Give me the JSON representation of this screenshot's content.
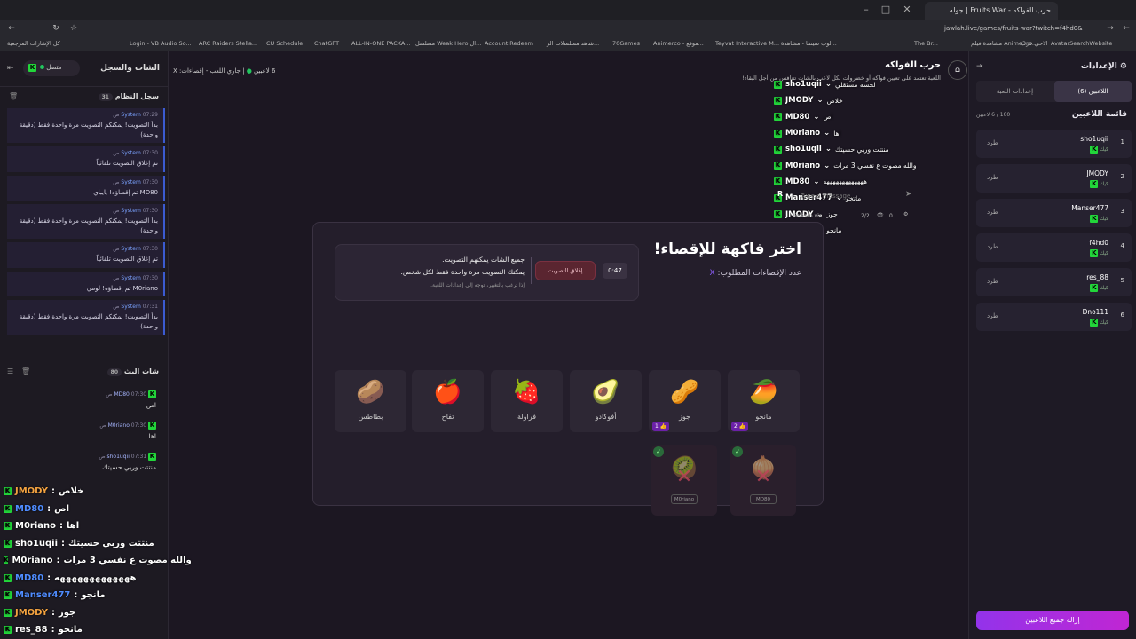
{
  "browser": {
    "tab_title": "حرب الفواكه - Fruits War | جوله",
    "url": "jawlah.live/games/fruits-war?twitch=f4hd0&kick=f4hd0",
    "bookmarks": [
      "كل الإشارات المرجعية",
      "Login - VB Audio So...",
      "ARC Raiders Stella...",
      "CU Schedule",
      "ChatGPT",
      "ALL-IN-ONE PACKA...",
      "مسلسل Weak Hero ال...",
      "Account Redeem",
      "شاهد مسلسلات الر...",
      "70Games",
      "Animerco - موقع...",
      "Teyvat Interactive M...",
      "لوب سينما - مشاهدة...",
      "The Br...",
      "مشاهدة فيلم Anime3rb...",
      "الاحي عرب",
      "AvatarSearchWebsite"
    ]
  },
  "left_panel": {
    "title": "الشات والسجل",
    "status": "متصل",
    "system_log": {
      "title": "سجل النظام",
      "count": "31",
      "messages": [
        {
          "sender": "System",
          "time": "07:29 ص",
          "text": "بدأ التصويت! يمكنكم التصويت مرة واحدة فقط (دقيقة واحدة)"
        },
        {
          "sender": "System",
          "time": "07:30 ص",
          "text": "تم إغلاق التصويت تلقائياً"
        },
        {
          "sender": "System",
          "time": "07:30 ص",
          "text": "MD80 تم إقصاؤه! بايباي"
        },
        {
          "sender": "System",
          "time": "07:30 ص",
          "text": "بدأ التصويت! يمكنكم التصويت مرة واحدة فقط (دقيقة واحدة)"
        },
        {
          "sender": "System",
          "time": "07:30 ص",
          "text": "تم إغلاق التصويت تلقائياً"
        },
        {
          "sender": "System",
          "time": "07:30 ص",
          "text": "M0riano تم إقصاؤه! لومي"
        },
        {
          "sender": "System",
          "time": "07:31 ص",
          "text": "بدأ التصويت! يمكنكم التصويت مرة واحدة فقط (دقيقة واحدة)"
        }
      ]
    },
    "stream_chat": {
      "title": "شات البث",
      "count": "80",
      "messages": [
        {
          "user": "MD80",
          "time": "07:30 ص",
          "text": "اص"
        },
        {
          "user": "M0riano",
          "time": "07:30 ص",
          "text": "اها"
        },
        {
          "user": "sho1uqii",
          "time": "07:31 ص",
          "text": "منتتت وربي حسيتك"
        }
      ]
    }
  },
  "overlay_chat": [
    {
      "user": "JMODY",
      "text": "خلاص",
      "color": "#f4a340"
    },
    {
      "user": "MD80",
      "text": "اص",
      "color": "#4f8cff"
    },
    {
      "user": "M0riano",
      "text": "اها",
      "color": "#ffffff"
    },
    {
      "user": "sho1uqii",
      "text": "منتتت وربي حسيتك",
      "color": "#ffffff"
    },
    {
      "user": "M0riano",
      "text": "والله مصوت ع نفسي 3 مرات",
      "color": "#ffffff"
    },
    {
      "user": "MD80",
      "text": "هههههههههههههه",
      "color": "#4f8cff"
    },
    {
      "user": "Manser477",
      "text": "مانجو",
      "color": "#4f8cff"
    },
    {
      "user": "JMODY",
      "text": "جوز",
      "color": "#f4a340"
    },
    {
      "user": "res_88",
      "text": "مانجو",
      "color": "#ffffff"
    }
  ],
  "top_chat": [
    {
      "user": "sho1uqii",
      "text": "لحسه مستقلي"
    },
    {
      "user": "JMODY",
      "text": "خلاص"
    },
    {
      "user": "MD80",
      "text": "اص"
    },
    {
      "user": "M0riano",
      "text": "اها"
    },
    {
      "user": "sho1uqii",
      "text": "منتتت وربي حسيتك"
    },
    {
      "user": "M0riano",
      "text": "والله مصوت ع نفسي 3 مرات"
    },
    {
      "user": "MD80",
      "text": "هههههههههههههه"
    },
    {
      "user": "Manser477",
      "text": "مانجو"
    },
    {
      "user": "JMODY",
      "text": "جوز"
    },
    {
      "user": "res_88",
      "text": "مانجو"
    }
  ],
  "chat_input": {
    "placeholder": "Type a message...",
    "stream_via": "Stream via ...",
    "viewers": "2/2",
    "eye": "0"
  },
  "game_header": {
    "title": "حرب الفواكه",
    "description": "اللعبة تعتمد على تعيين فواكه أو خضروات لكل لاعب بالشات تتنافس من أجل البقاء!",
    "players_count": "6 لاعبين",
    "status": "جاري اللعب - إقصاءات: X"
  },
  "modal": {
    "title": "اختر فاكهة للإقصاء!",
    "subtitle": "عدد الإقصاءات المطلوب:",
    "x_mark": "X",
    "timer": "0:47",
    "close_vote": "إغلاق التصويت",
    "line1": "جميع الشات يمكنهم التصويت.",
    "line2": "يمكنك التصويت مرة واحدة فقط لكل شخص.",
    "line3": "إذا ترغب بالتغيير، توجه إلى إعدادات اللعبة.",
    "fruits": [
      {
        "name": "مانجو",
        "icon": "mango-icon",
        "emoji": "🥭",
        "votes": "2"
      },
      {
        "name": "جوز",
        "icon": "walnut-icon",
        "emoji": "🥜",
        "votes": "1"
      },
      {
        "name": "أفوكادو",
        "icon": "avocado-icon",
        "emoji": "🥑",
        "votes": ""
      },
      {
        "name": "فراولة",
        "icon": "strawberry-icon",
        "emoji": "🍓",
        "votes": ""
      },
      {
        "name": "تفاح",
        "icon": "apple-icon",
        "emoji": "🍎",
        "votes": ""
      },
      {
        "name": "بطاطس",
        "icon": "potato-icon",
        "emoji": "🥔",
        "votes": ""
      }
    ],
    "eliminated": [
      {
        "player": "MD80",
        "icon": "onion-icon",
        "emoji": "🧅"
      },
      {
        "player": "M0riano",
        "icon": "kiwi-icon",
        "emoji": "🥝"
      }
    ]
  },
  "right_panel": {
    "title": "الإعدادات",
    "tab_players": "اللاعبين (6)",
    "tab_settings": "إعدادات اللعبة",
    "list_title": "قائمة اللاعبين",
    "list_count": "100 / 6 لاعبين",
    "kick_label": "طرد",
    "platform": "كيك",
    "players": [
      {
        "num": "1",
        "name": "sho1uqii"
      },
      {
        "num": "2",
        "name": "JMODY"
      },
      {
        "num": "3",
        "name": "Manser477"
      },
      {
        "num": "4",
        "name": "f4hd0"
      },
      {
        "num": "5",
        "name": "res_88"
      },
      {
        "num": "6",
        "name": "Dno111"
      }
    ],
    "kick_all": "إزالة جميع اللاعبين"
  }
}
